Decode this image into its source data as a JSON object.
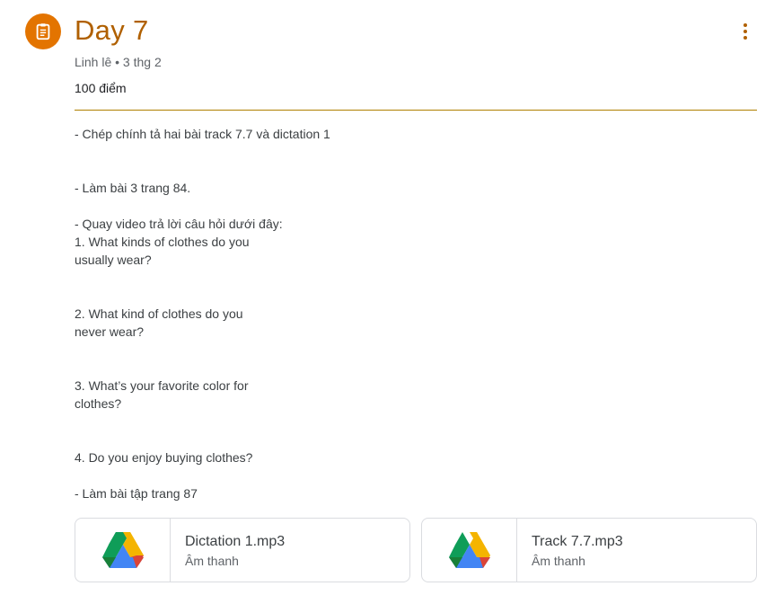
{
  "assignment": {
    "icon": "assignment-icon",
    "title": "Day 7",
    "meta": "Linh lê • 3 thg 2",
    "points": "100 điểm",
    "accent_color": "#b06000",
    "icon_bg_color": "#e37400"
  },
  "menu": {
    "icon": "more-vert-icon"
  },
  "instructions": [
    "- Chép chính tả hai bài track 7.7 và dictation 1",
    "",
    "",
    "- Làm bài 3 trang 84.",
    "",
    "- Quay video trả lời câu hỏi dưới đây:",
    "1. What kinds of clothes do you",
    "usually wear?",
    "",
    "",
    "2. What kind of clothes do you",
    "never wear?",
    "",
    "",
    "3. What’s your favorite color for",
    "clothes?",
    "",
    "",
    "4. Do you enjoy buying clothes?",
    "",
    "- Làm bài tập trang 87"
  ],
  "attachments": [
    {
      "icon": "google-drive-icon",
      "name": "Dictation 1.mp3",
      "type": "Âm thanh"
    },
    {
      "icon": "google-drive-icon",
      "name": "Track 7.7.mp3",
      "type": "Âm thanh"
    }
  ]
}
